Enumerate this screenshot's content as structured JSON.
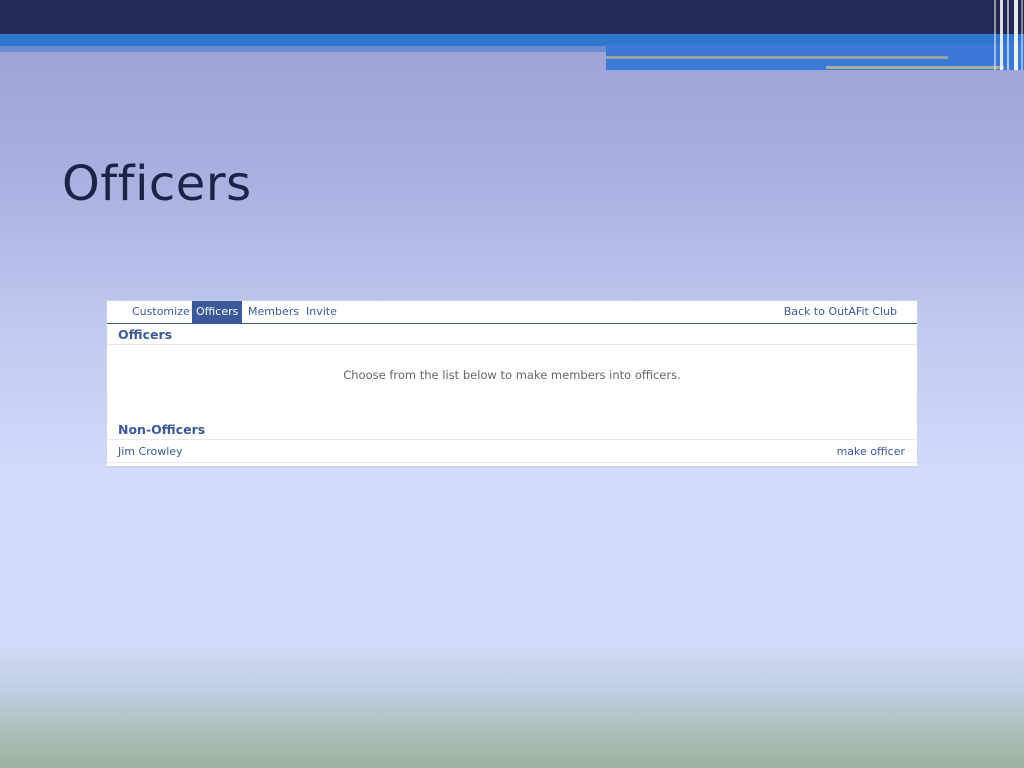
{
  "slide": {
    "title": "Officers"
  },
  "panel": {
    "tabs": [
      {
        "label": "Customize"
      },
      {
        "label": "Officers",
        "active": true
      },
      {
        "label": "Members"
      },
      {
        "label": "Invite"
      }
    ],
    "back_link": "Back to OutAFit Club",
    "officers_heading": "Officers",
    "instructions": "Choose from the list below to make members into officers.",
    "non_officers_heading": "Non-Officers",
    "members": [
      {
        "name": "Jim Crowley",
        "action": "make officer"
      }
    ]
  },
  "colors": {
    "accent": "#3b5998",
    "title_text": "#1c2348",
    "header_navy": "#242855",
    "header_blue": "#2f76cf"
  }
}
